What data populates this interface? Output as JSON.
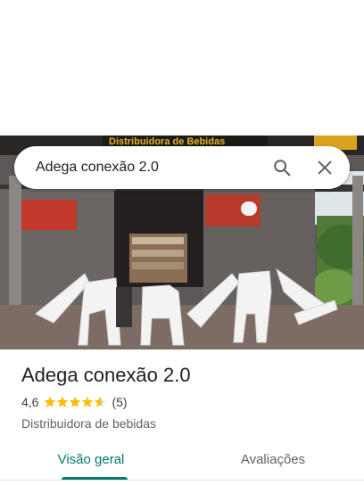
{
  "search": {
    "value": "Adega conexão 2.0",
    "search_icon": "search-icon",
    "clear_icon": "close-icon"
  },
  "photo": {
    "sign_text": "Distribuidora de Bebidas"
  },
  "place": {
    "name": "Adega conexão 2.0",
    "rating": "4,6",
    "rating_value": 4.6,
    "review_count": "(5)",
    "category": "Distribuidora de bebidas"
  },
  "tabs": [
    {
      "label": "Visão geral",
      "active": true
    },
    {
      "label": "Avaliações",
      "active": false
    }
  ],
  "colors": {
    "accent": "#00796b",
    "star": "#fbbc04",
    "text_primary": "#202124",
    "text_secondary": "#5f6368"
  }
}
